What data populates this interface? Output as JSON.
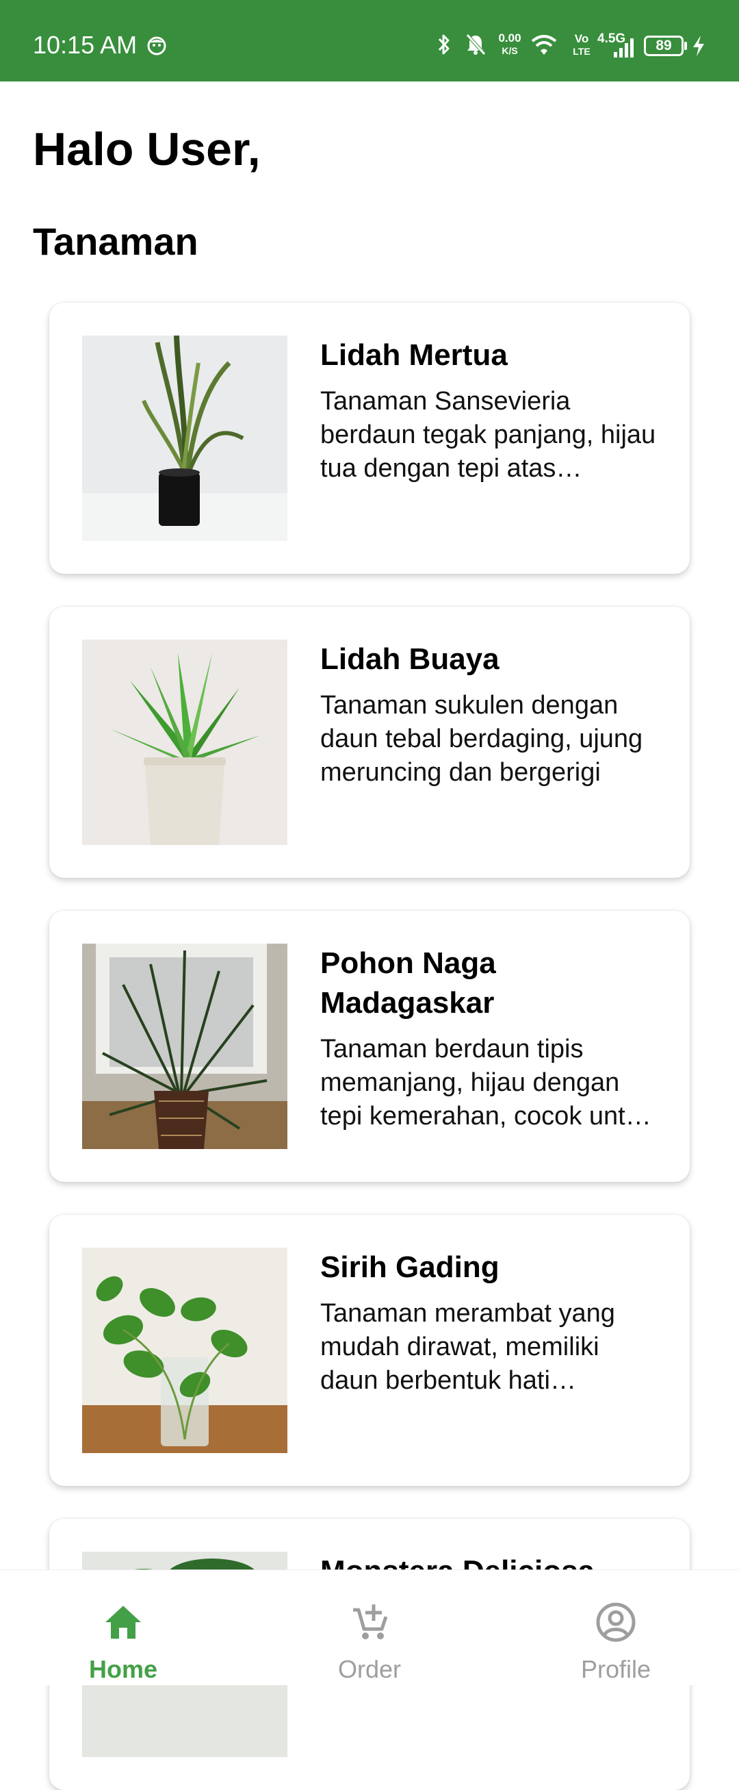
{
  "status_bar": {
    "time": "10:15 AM",
    "net_speed_value": "0.00",
    "net_speed_unit": "K/S",
    "volte_top": "Vo",
    "volte_bottom": "LTE",
    "network_type": "4.5G",
    "battery": "89",
    "icons": [
      "bluetooth-icon",
      "mute-bell-icon",
      "wifi-icon",
      "signal-icon",
      "charging-icon"
    ]
  },
  "header": {
    "greeting": "Halo User,",
    "section_title": "Tanaman"
  },
  "plants": [
    {
      "name": "Lidah Mertua",
      "description": "Tanaman Sansevieria berdaun tegak panjang, hijau tua dengan tepi atas kekuningan"
    },
    {
      "name": "Lidah Buaya",
      "description": "Tanaman sukulen dengan daun tebal berdaging, ujung meruncing dan bergerigi"
    },
    {
      "name": "Pohon Naga Madagaskar",
      "description": "Tanaman berdaun tipis memanjang, hijau dengan tepi kemerahan, cocok untuk ruangan"
    },
    {
      "name": "Sirih Gading",
      "description": "Tanaman merambat yang mudah dirawat, memiliki daun berbentuk hati berwarna hijau"
    },
    {
      "name": "Monstera Deliciosa",
      "description": ""
    }
  ],
  "bottom_nav": {
    "items": [
      {
        "label": "Home",
        "icon": "home-icon",
        "active": true
      },
      {
        "label": "Order",
        "icon": "cart-add-icon",
        "active": false
      },
      {
        "label": "Profile",
        "icon": "account-circle-icon",
        "active": false
      }
    ]
  },
  "colors": {
    "status_bar": "#388e3c",
    "nav_active": "#43a047",
    "nav_inactive": "#9e9e9e"
  }
}
